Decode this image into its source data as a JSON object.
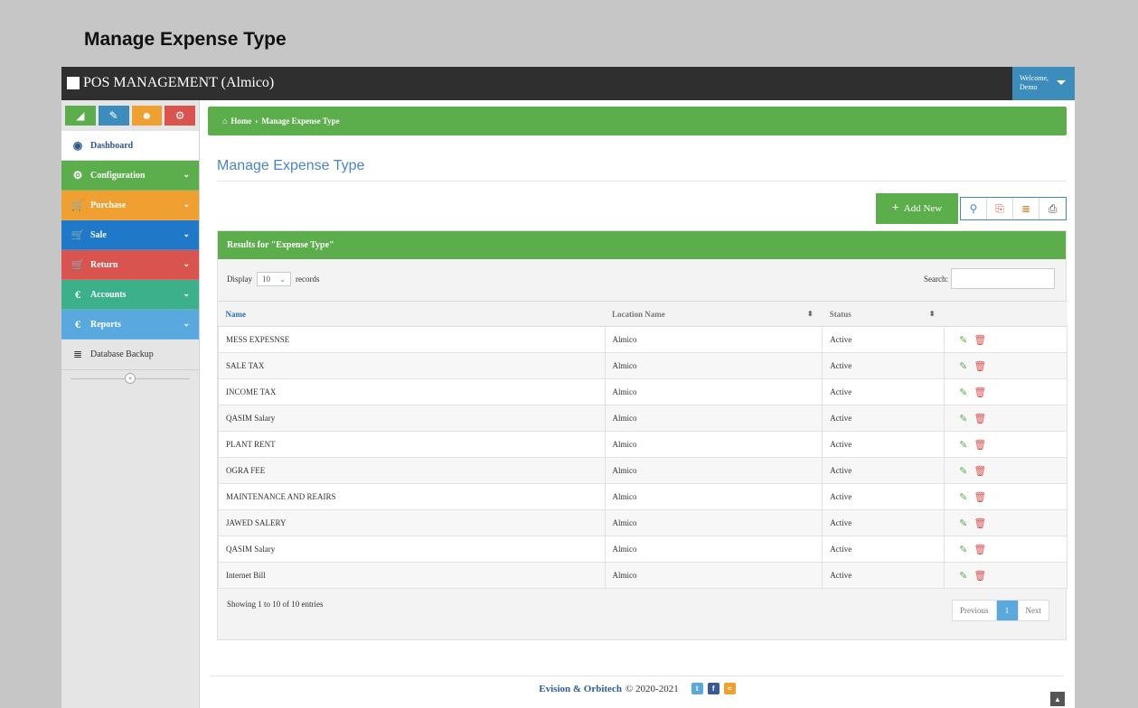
{
  "outer_title": "Manage Expense Type",
  "topbar": {
    "brand": "POS MANAGEMENT (Almico)",
    "welcome_line1": "Welcome,",
    "welcome_line2": "Demo"
  },
  "sidebar": {
    "shortcut_colors": [
      "#5cae4c",
      "#3c8dbc",
      "#f0a030",
      "#d9534f"
    ],
    "items": [
      {
        "label": "Dashboard",
        "icon": "dashboard-icon",
        "color": "#ffffff"
      },
      {
        "label": "Configuration",
        "icon": "cogs-icon",
        "color": "#5cae4c"
      },
      {
        "label": "Purchase",
        "icon": "cart-icon",
        "color": "#f0a030"
      },
      {
        "label": "Sale",
        "icon": "cart-icon",
        "color": "#1f78c8"
      },
      {
        "label": "Return",
        "icon": "cart-icon",
        "color": "#d9534f"
      },
      {
        "label": "Accounts",
        "icon": "euro-icon",
        "color": "#3cb08a"
      },
      {
        "label": "Reports",
        "icon": "euro-icon",
        "color": "#5aa9de"
      },
      {
        "label": "Database Backup",
        "icon": "database-icon",
        "color": "#e5e5e5"
      }
    ]
  },
  "breadcrumb": {
    "home": "Home",
    "separator": "›",
    "current": "Manage Expense Type"
  },
  "page_title": "Manage Expense Type",
  "toolbar": {
    "add_label": "Add New"
  },
  "panel": {
    "heading": "Results for \"Expense Type\"",
    "display_label": "Display",
    "page_size": "10",
    "records_label": "records",
    "search_label": "Search:",
    "search_value": ""
  },
  "table": {
    "columns": [
      "Name",
      "Location Name",
      "Status",
      ""
    ],
    "rows": [
      {
        "name": "MESS EXPESNSE",
        "location": "Almico",
        "status": "Active"
      },
      {
        "name": "SALE TAX",
        "location": "Almico",
        "status": "Active"
      },
      {
        "name": "INCOME TAX",
        "location": "Almico",
        "status": "Active"
      },
      {
        "name": "QASIM Salary",
        "location": "Almico",
        "status": "Active"
      },
      {
        "name": "PLANT RENT",
        "location": "Almico",
        "status": "Active"
      },
      {
        "name": "OGRA FEE",
        "location": "Almico",
        "status": "Active"
      },
      {
        "name": "MAINTENANCE AND REAIRS",
        "location": "Almico",
        "status": "Active"
      },
      {
        "name": "JAWED SALERY",
        "location": "Almico",
        "status": "Active"
      },
      {
        "name": "QASIM Salary",
        "location": "Almico",
        "status": "Active"
      },
      {
        "name": "Internet Bill",
        "location": "Almico",
        "status": "Active"
      }
    ]
  },
  "table_footer": {
    "showing": "Showing 1 to 10 of 10 entries",
    "previous": "Previous",
    "current_page": "1",
    "next": "Next"
  },
  "footer": {
    "brand": "Evision & Orbitech",
    "copyright": "© 2020-2021"
  }
}
